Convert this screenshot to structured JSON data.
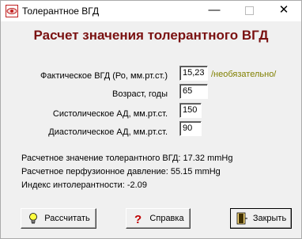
{
  "window": {
    "title": "Толерантное ВГД",
    "minimize_glyph": "—",
    "close_glyph": "✕"
  },
  "heading": "Расчет значения толерантного ВГД",
  "fields": [
    {
      "label": "Фактическое ВГД (Ро, мм.рт.ст.)",
      "value": "15,23"
    },
    {
      "label": "Возраст, годы",
      "value": "65"
    },
    {
      "label": "Систолическое АД, мм.рт.ст.",
      "value": "150"
    },
    {
      "label": "Диастолическое АД, мм.рт.ст.",
      "value": "90"
    }
  ],
  "hint": "/необязательно/",
  "results": [
    "Расчетное значение толерантного ВГД: 17.32 mmHg",
    "Расчетное перфузионное давление: 55.15 mmHg",
    "Индекс интолерантности: -2.09"
  ],
  "buttons": {
    "calculate": "Рассчитать",
    "help": "Справка",
    "close": "Закрыть"
  },
  "colors": {
    "heading": "#7a1111",
    "hint": "#808000",
    "window_bg": "#f0f0f0"
  },
  "icons": {
    "app": "app-eye-icon",
    "calculate": "lightbulb-icon",
    "help": "question-mark-icon",
    "close": "door-exit-icon"
  }
}
